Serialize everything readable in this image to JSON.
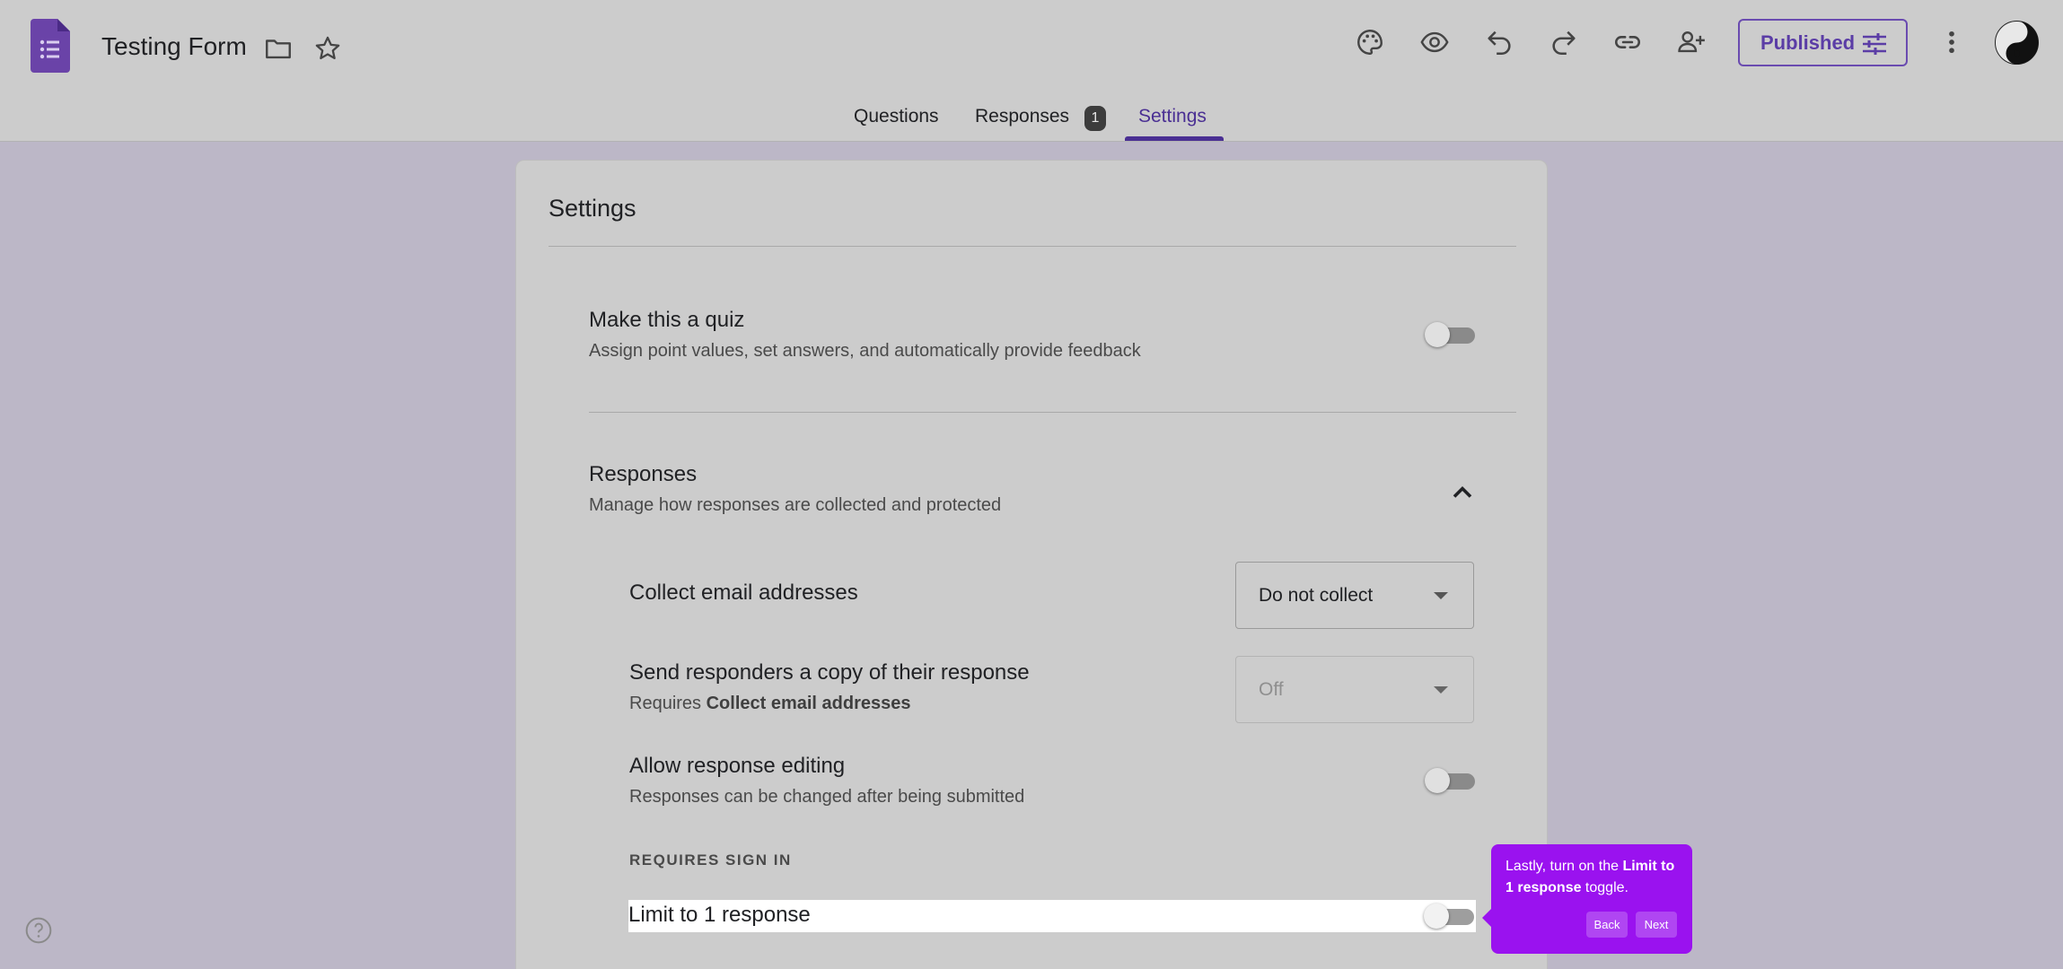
{
  "header": {
    "title": "Testing Form",
    "publish_label": "Published"
  },
  "tabs": [
    {
      "label": "Questions"
    },
    {
      "label": "Responses",
      "badge": "1"
    },
    {
      "label": "Settings"
    }
  ],
  "settings": {
    "title": "Settings",
    "quiz": {
      "title": "Make this a quiz",
      "subtitle": "Assign point values, set answers, and automatically provide feedback"
    },
    "responses": {
      "title": "Responses",
      "subtitle": "Manage how responses are collected and protected",
      "collect_email": {
        "title": "Collect email addresses",
        "value": "Do not collect"
      },
      "send_copy": {
        "title": "Send responders a copy of their response",
        "sub_prefix": "Requires ",
        "sub_bold": "Collect email addresses",
        "value": "Off"
      },
      "editing": {
        "title": "Allow response editing",
        "subtitle": "Responses can be changed after being submitted"
      },
      "requires_sign_in": "REQUIRES SIGN IN",
      "limit": {
        "title": "Limit to 1 response"
      }
    }
  },
  "tooltip": {
    "text_prefix": "Lastly, turn on the ",
    "text_bold": "Limit to 1 response",
    "text_suffix": " toggle.",
    "back": "Back",
    "next": "Next"
  },
  "colors": {
    "accent": "#4a2f93",
    "tooltip": "#9a12ef",
    "background": "#bcb7c7"
  }
}
